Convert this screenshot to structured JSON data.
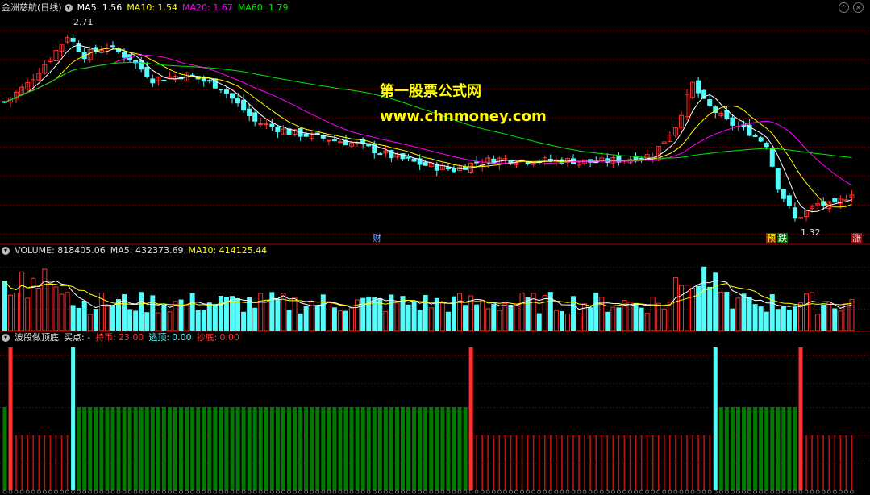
{
  "main_header": {
    "stock": "金洲慈航(日线)",
    "ma5": "MA5: 1.56",
    "ma10": "MA10: 1.54",
    "ma20": "MA20: 1.67",
    "ma60": "MA60: 1.79"
  },
  "vol_header": {
    "title": "VOLUME: 818405.06",
    "ma5": "MA5: 432373.69",
    "ma10": "MA10: 414125.44"
  },
  "ind_header": {
    "title": "波段做顶底",
    "buy": "买点: -",
    "hold_label": "持币:",
    "hold_value": "23.00",
    "top_label": "逃顶:",
    "top_value": "0.00",
    "bottom_label": "抄底:",
    "bottom_value": "0.00"
  },
  "watermark": {
    "line1": "第一股票公式网",
    "line2": "www.chnmoney.com"
  },
  "labels": {
    "high": "2.71",
    "low": "1.32",
    "cai": "财",
    "yu": "预",
    "die": "跌",
    "zhang": "涨"
  },
  "colors": {
    "up": "#ff3030",
    "down": "#54fcfc",
    "ma5": "#ffffff",
    "ma10": "#ffff00",
    "ma20": "#ff00ff",
    "ma60": "#00e600",
    "grid": "#7a0000",
    "green_bar": "#007b00"
  },
  "icons": {
    "header_circle": "chevron-down-icon",
    "window_buttons": [
      "minimize-icon",
      "close-icon"
    ]
  }
}
